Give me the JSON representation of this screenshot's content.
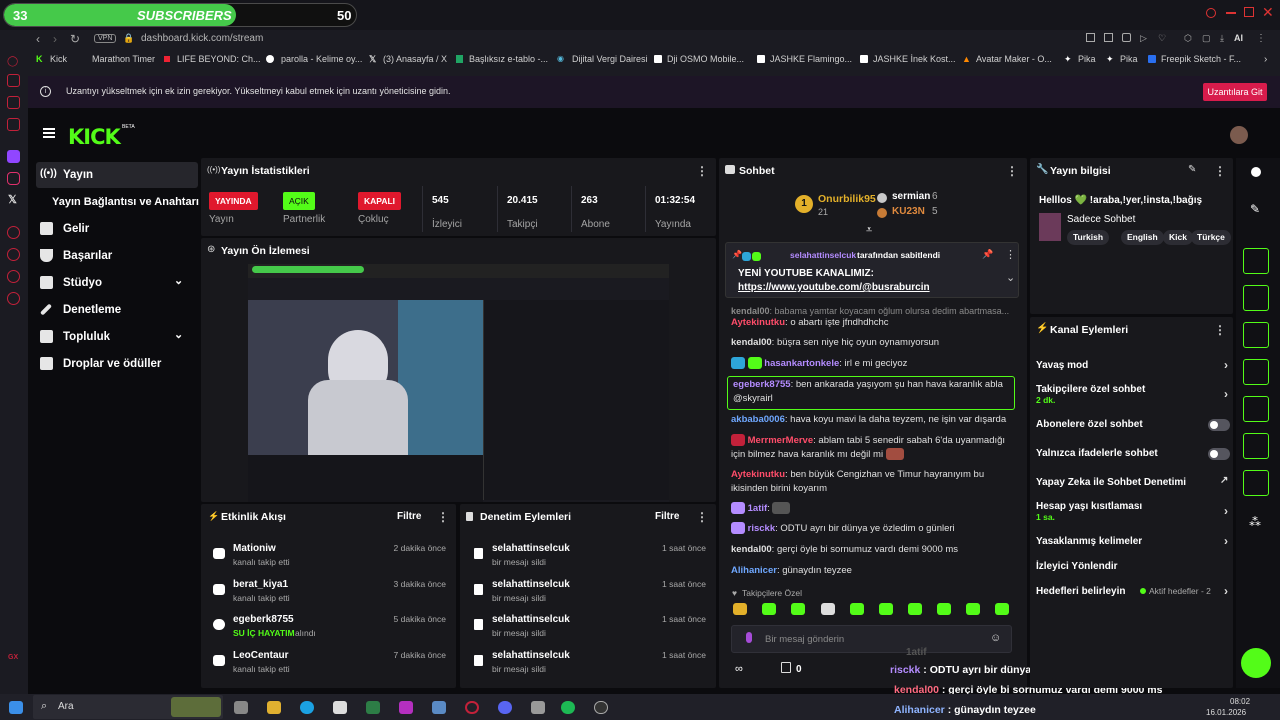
{
  "overlay": {
    "sub_current": "33",
    "sub_label": "SUBSCRIBERS",
    "sub_goal": "50",
    "progress": 0.66
  },
  "browser": {
    "url": "dashboard.kick.com/stream",
    "vpn": "VPN",
    "ai_label": "AI"
  },
  "bookmarks": [
    "Kick",
    "Marathon Timer",
    "LIFE BEYOND: Ch...",
    "parolla - Kelime oy...",
    "(3) Anasayfa / X",
    "Başlıksız e-tablo -...",
    "Dijital Vergi Dairesi",
    "Dji OSMO Mobile...",
    "JASHKE Flamingo...",
    "JASHKE İnek Kost...",
    "Avatar Maker - O...",
    "Pika",
    "Pika",
    "Freepik Sketch - F..."
  ],
  "banner": {
    "text": "Uzantıyı yükseltmek için ek izin gerekiyor. Yükseltmeyi kabul etmek için uzantı yöneticisine gidin.",
    "button": "Uzantılara Git"
  },
  "logo": "KICK",
  "logo_badge": "BETA",
  "sidebar": {
    "items": [
      {
        "label": "Yayın",
        "icon": "broadcast-icon"
      },
      {
        "label": "Yayın Bağlantısı ve Anahtarı",
        "icon": ""
      },
      {
        "label": "Gelir",
        "icon": "chart-icon"
      },
      {
        "label": "Başarılar",
        "icon": "trophy-icon"
      },
      {
        "label": "Stüdyo",
        "icon": "studio-icon"
      },
      {
        "label": "Denetleme",
        "icon": "wrench-icon"
      },
      {
        "label": "Topluluk",
        "icon": "community-icon"
      },
      {
        "label": "Droplar ve ödüller",
        "icon": "gift-icon"
      }
    ]
  },
  "stats": {
    "title": "Yayın İstatistikleri",
    "status": [
      {
        "value": "YAYINDA",
        "label": "Yayın",
        "color": "#e0182d"
      },
      {
        "value": "AÇIK",
        "label": "Partnerlik",
        "color": "#53fc18"
      },
      {
        "value": "KAPALI",
        "label": "Çokluç",
        "color": "#e0182d"
      }
    ],
    "numbers": [
      {
        "value": "545",
        "label": "İzleyici"
      },
      {
        "value": "20.415",
        "label": "Takipçi"
      },
      {
        "value": "263",
        "label": "Abone"
      },
      {
        "value": "01:32:54",
        "label": "Yayında"
      }
    ]
  },
  "preview": {
    "title": "Yayın Ön İzlemesi"
  },
  "activity": {
    "title": "Etkinlik Akışı",
    "filter": "Filtre",
    "items": [
      {
        "name": "Mationiw",
        "sub": "kanalı takip etti",
        "time": "2 dakika önce",
        "icon": "heart-icon"
      },
      {
        "name": "berat_kiya1",
        "sub": "kanalı takip etti",
        "time": "3 dakika önce",
        "icon": "heart-icon"
      },
      {
        "name": "egeberk8755",
        "sub_highlight": "SU İÇ HAYATIM",
        "sub": "alındı",
        "time": "5 dakika önce",
        "icon": "drop-icon"
      },
      {
        "name": "LeoCentaur",
        "sub": "kanalı takip etti",
        "time": "7 dakika önce",
        "icon": "heart-icon"
      }
    ]
  },
  "moderation": {
    "title": "Denetim Eylemleri",
    "filter": "Filtre",
    "items": [
      {
        "name": "selahattinselcuk",
        "sub": "bir mesajı sildi",
        "time": "1 saat önce"
      },
      {
        "name": "selahattinselcuk",
        "sub": "bir mesajı sildi",
        "time": "1 saat önce"
      },
      {
        "name": "selahattinselcuk",
        "sub": "bir mesajı sildi",
        "time": "1 saat önce"
      },
      {
        "name": "selahattinselcuk",
        "sub": "bir mesajı sildi",
        "time": "1 saat önce"
      }
    ]
  },
  "chat": {
    "title": "Sohbet",
    "top": [
      {
        "rank": "1",
        "name": "Onurbilik95",
        "count": "21"
      },
      {
        "name": "sermian",
        "count": "6"
      },
      {
        "name": "KU23N",
        "count": "5"
      }
    ],
    "pinned": {
      "by": "selahattinselcuk",
      "suffix": "tarafından sabitlendi",
      "text": "YENİ YOUTUBE KANALIMIZ:",
      "link": "https://www.youtube.com/@busraburcin"
    },
    "messages": [
      {
        "user": "kendal00",
        "text": "babama yamtar koyacam oğlum olursa dedim abartmasa...",
        "color": "#8a8a8a"
      },
      {
        "user": "Aytekinutku",
        "text": "o abartı işte jfndhdhchc",
        "color": "#ff4d6a"
      },
      {
        "user": "kendal00",
        "text": "büşra sen niye hiç oyun oynamıyorsun",
        "color": "#e6e6e6"
      },
      {
        "user": "hasankartonkele",
        "text": "irl e mi geciyoz",
        "color": "#b48cff"
      },
      {
        "user": "egeberk8755",
        "text": "ben ankarada yaşıyom şu han hava karanlık abla @skyrairl",
        "color": "#b48cff"
      },
      {
        "user": "akbaba0006",
        "text": "hava koyu mavi la daha teyzem, ne işin var dışarda",
        "color": "#6fa8ff"
      },
      {
        "user": "MerrmerMerve",
        "text": "ablam tabi 5 senedir sabah 6'da uyanmadığı için bilmez hava karanlık mı değil mi",
        "color": "#ff4d6a"
      },
      {
        "user": "Aytekinutku",
        "text": "ben büyük Cengizhan ve Timur hayranıyım bu ikisinden birini koyarım",
        "color": "#ff4d6a"
      },
      {
        "user": "1atif",
        "text": "",
        "color": "#b48cff"
      },
      {
        "user": "risckk",
        "text": "ODTU ayrı bir dünya ye özledim o günleri",
        "color": "#b48cff"
      },
      {
        "user": "kendal00",
        "text": "gerçi öyle bi sornumuz vardı demi 9000 ms",
        "color": "#e6e6e6"
      },
      {
        "user": "Alihanicer",
        "text": "günaydın teyzee",
        "color": "#6fa8ff"
      }
    ],
    "emote_section": "Takipçilere Özel",
    "input_placeholder": "Bir mesaj gönderin",
    "count": "0"
  },
  "overlay_chat": [
    {
      "user": "risckk",
      "text": "ODTU ayrı bir dünya ye özledim o günleri"
    },
    {
      "user": "kendal00",
      "text": "gerçi öyle bi sornumuz vardı demi 9000 ms"
    },
    {
      "user": "Alihanicer",
      "text": "günaydın teyzee"
    }
  ],
  "overlay_name": "1atif",
  "info": {
    "title": "Yayın bilgisi",
    "stream_title": "Helllos 💚 !araba,!yer,!insta,!bağış",
    "category": "Sadece Sohbet",
    "tags": [
      "Turkish",
      "English",
      "Kick",
      "Türkçe"
    ]
  },
  "channel": {
    "title": "Kanal Eylemleri",
    "items": [
      {
        "label": "Yavaş mod",
        "kind": "chevron"
      },
      {
        "label": "Takipçilere özel sohbet",
        "sub": "2 dk.",
        "kind": "chevron"
      },
      {
        "label": "Abonelere özel sohbet",
        "kind": "toggle"
      },
      {
        "label": "Yalnızca ifadelerle sohbet",
        "kind": "toggle"
      },
      {
        "label": "Yapay Zeka ile Sohbet Denetimi",
        "kind": "external"
      },
      {
        "label": "Hesap yaşı kısıtlaması",
        "sub": "1 sa.",
        "kind": "chevron"
      },
      {
        "label": "Yasaklanmış kelimeler",
        "kind": "chevron"
      },
      {
        "label": "İzleyici Yönlendir",
        "kind": "none"
      },
      {
        "label": "Hedefleri belirleyin",
        "extra": "Aktif hedefler - 2",
        "kind": "chevron"
      }
    ]
  },
  "taskbar": {
    "search": "Ara",
    "time": "08:02",
    "date": "16.01.2026"
  },
  "colors": {
    "accent": "#53fc18",
    "danger": "#e0182d"
  }
}
